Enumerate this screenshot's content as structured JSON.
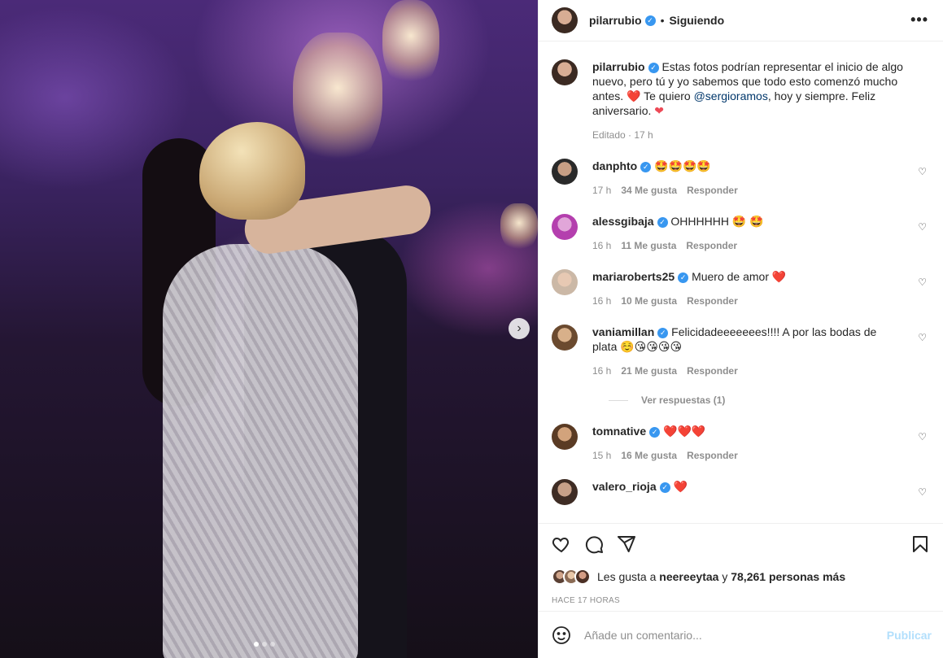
{
  "header": {
    "username": "pilarrubio",
    "separator": "•",
    "following_label": "Siguiendo",
    "more_label": "•••"
  },
  "caption": {
    "username": "pilarrubio",
    "text_part1": "Estas fotos podrían representar el inicio de algo nuevo, pero tú y yo sabemos que todo esto comenzó mucho antes.",
    "heart1": "❤️",
    "text_part2": " Te quiero ",
    "mention": "@sergioramos",
    "text_part3": ", hoy y siempre. Feliz aniversario.",
    "heart2": "❤",
    "meta": "Editado · 17 h"
  },
  "comments": [
    {
      "username": "danphto",
      "text": "🤩🤩🤩🤩",
      "time": "17 h",
      "likes": "34 Me gusta",
      "reply": "Responder"
    },
    {
      "username": "alessgibaja",
      "text": "OHHHHHH 🤩 🤩",
      "time": "16 h",
      "likes": "11 Me gusta",
      "reply": "Responder"
    },
    {
      "username": "mariaroberts25",
      "text": "Muero de amor ❤️",
      "time": "16 h",
      "likes": "10 Me gusta",
      "reply": "Responder"
    },
    {
      "username": "vaniamillan",
      "text": "Felicidadeeeeeees!!!! A por las bodas de plata ☺️😘😘😘😘",
      "time": "16 h",
      "likes": "21 Me gusta",
      "reply": "Responder"
    },
    {
      "username": "tomnative",
      "text": "❤️❤️❤️",
      "time": "15 h",
      "likes": "16 Me gusta",
      "reply": "Responder"
    },
    {
      "username": "valero_rioja",
      "text": "❤️",
      "time": "",
      "likes": "",
      "reply": ""
    }
  ],
  "view_replies": "Ver respuestas (1)",
  "likes": {
    "prefix": "Les gusta a",
    "user": "neereeytaa",
    "connector": "y",
    "others": "78,261 personas más"
  },
  "timestamp": "HACE 17 HORAS",
  "add_comment": {
    "placeholder": "Añade un comentario...",
    "publish_label": "Publicar"
  },
  "colors": {
    "verified": "#3897f0",
    "heart": "#ed4956",
    "publish_disabled": "#b2dffc",
    "mention": "#00376b"
  }
}
